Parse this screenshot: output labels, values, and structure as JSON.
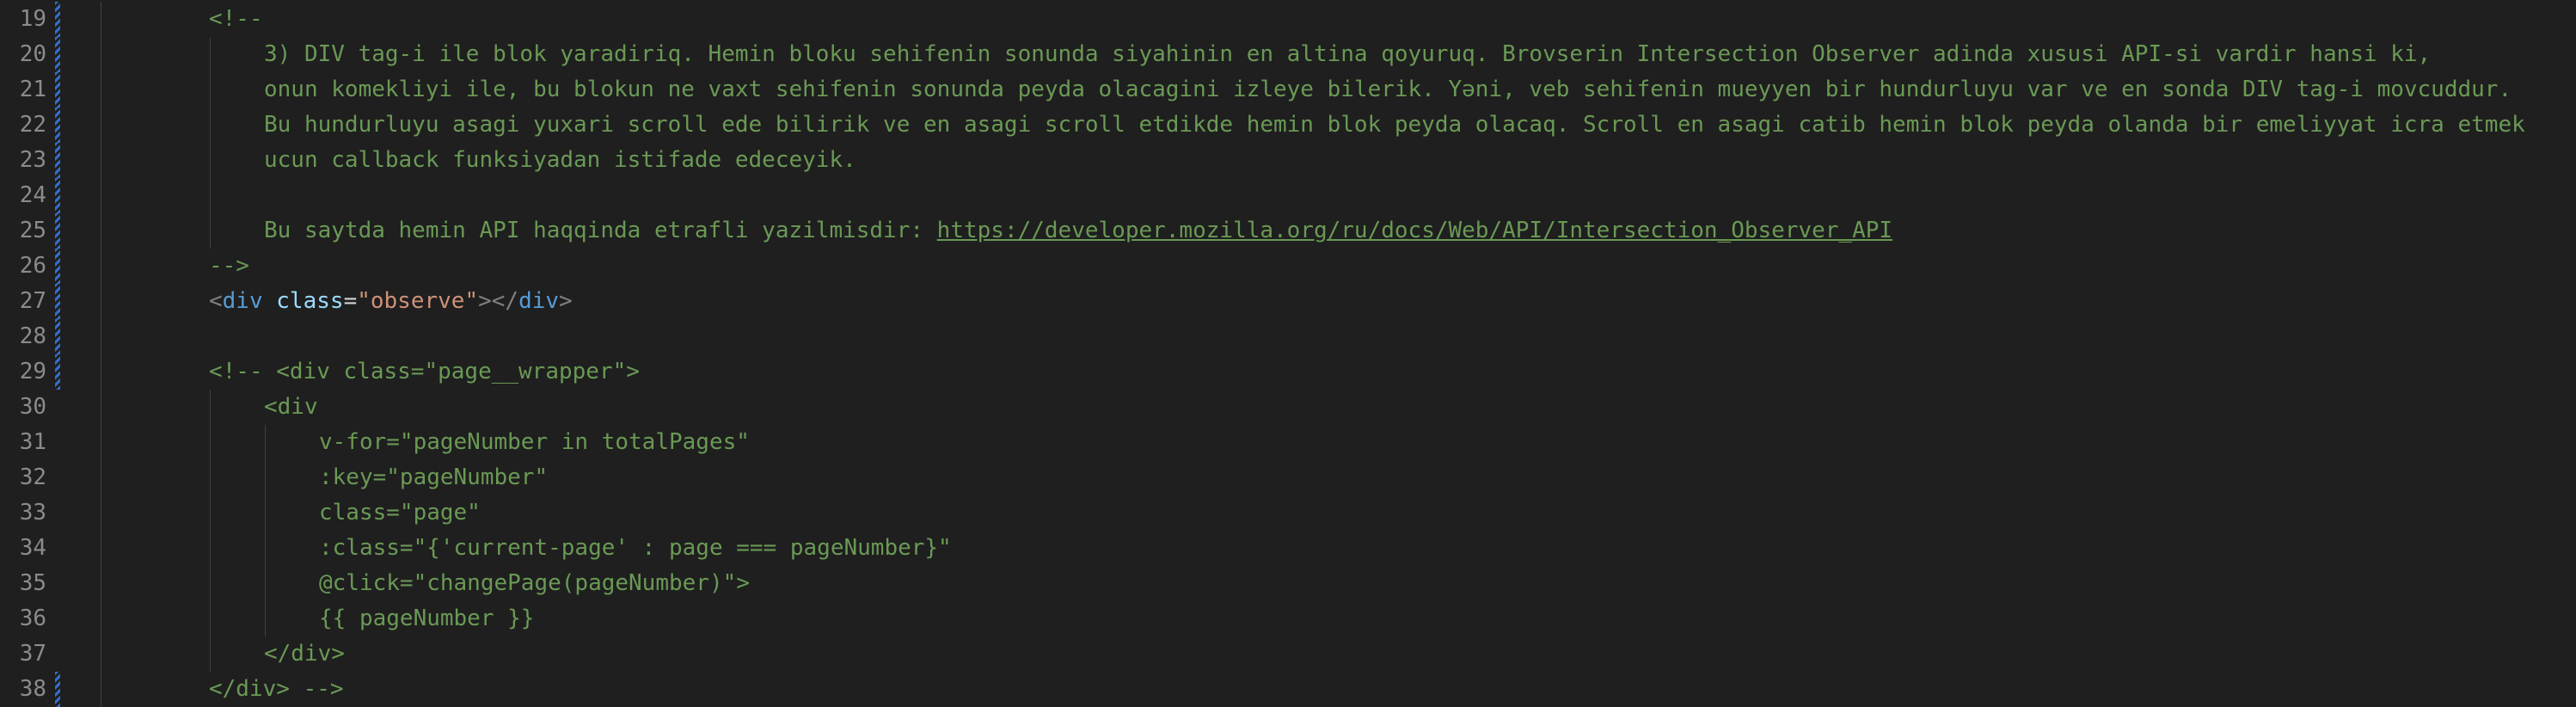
{
  "editor": {
    "lines": [
      {
        "num": "19",
        "indent": 1,
        "guides": [
          1
        ],
        "git": true,
        "segments": [
          {
            "t": "<!--",
            "c": "cm"
          }
        ]
      },
      {
        "num": "20",
        "indent": 2,
        "guides": [
          1,
          2
        ],
        "git": true,
        "segments": [
          {
            "t": "3) DIV tag-i ile blok yaradiriq. Hemin bloku sehifenin sonunda siyahinin en altina qoyuruq. Brovserin Intersection Observer adinda xususi API-si vardir hansi ki,",
            "c": "cm"
          }
        ]
      },
      {
        "num": "21",
        "indent": 2,
        "guides": [
          1,
          2
        ],
        "git": true,
        "segments": [
          {
            "t": "onun komekliyi ile, bu blokun ne vaxt sehifenin sonunda peyda olacagini izleye bilerik. Yəni, veb sehifenin mueyyen bir hundurluyu var ve en sonda DIV tag-i movcuddur.",
            "c": "cm"
          }
        ]
      },
      {
        "num": "22",
        "indent": 2,
        "guides": [
          1,
          2
        ],
        "git": true,
        "segments": [
          {
            "t": "Bu hundurluyu asagi yuxari scroll ede bilirik ve en asagi scroll etdikde hemin blok peyda olacaq. Scroll en asagi catib hemin blok peyda olanda bir emeliyyat icra etmek",
            "c": "cm"
          }
        ]
      },
      {
        "num": "23",
        "indent": 2,
        "guides": [
          1,
          2
        ],
        "git": true,
        "segments": [
          {
            "t": "ucun callback funksiyadan istifade edeceyik.",
            "c": "cm"
          }
        ]
      },
      {
        "num": "24",
        "indent": 2,
        "guides": [
          1,
          2
        ],
        "git": true,
        "segments": []
      },
      {
        "num": "25",
        "indent": 2,
        "guides": [
          1,
          2
        ],
        "git": true,
        "segments": [
          {
            "t": "Bu saytda hemin API haqqinda etrafli yazilmisdir: ",
            "c": "cm"
          },
          {
            "t": "https://developer.mozilla.org/ru/docs/Web/API/Intersection_Observer_API",
            "c": "link"
          }
        ]
      },
      {
        "num": "26",
        "indent": 1,
        "guides": [
          1
        ],
        "git": true,
        "segments": [
          {
            "t": "-->",
            "c": "cm"
          }
        ]
      },
      {
        "num": "27",
        "indent": 1,
        "guides": [
          1
        ],
        "git": true,
        "segments": [
          {
            "t": "<",
            "c": "punc"
          },
          {
            "t": "div",
            "c": "tag"
          },
          {
            "t": " ",
            "c": "plain"
          },
          {
            "t": "class",
            "c": "attr"
          },
          {
            "t": "=",
            "c": "plain"
          },
          {
            "t": "\"observe\"",
            "c": "str"
          },
          {
            "t": "></",
            "c": "punc"
          },
          {
            "t": "div",
            "c": "tag"
          },
          {
            "t": ">",
            "c": "punc"
          }
        ]
      },
      {
        "num": "28",
        "indent": 1,
        "guides": [
          1
        ],
        "git": true,
        "segments": []
      },
      {
        "num": "29",
        "indent": 1,
        "guides": [
          1
        ],
        "git": true,
        "segments": [
          {
            "t": "<!-- <div class=\"page__wrapper\">",
            "c": "cm"
          }
        ]
      },
      {
        "num": "30",
        "indent": 2,
        "guides": [
          1,
          2
        ],
        "git": false,
        "segments": [
          {
            "t": "<div",
            "c": "cm"
          }
        ]
      },
      {
        "num": "31",
        "indent": 3,
        "guides": [
          1,
          2,
          3
        ],
        "git": false,
        "segments": [
          {
            "t": "v-for=\"pageNumber in totalPages\"",
            "c": "cm"
          }
        ]
      },
      {
        "num": "32",
        "indent": 3,
        "guides": [
          1,
          2,
          3
        ],
        "git": false,
        "segments": [
          {
            "t": ":key=\"pageNumber\"",
            "c": "cm"
          }
        ]
      },
      {
        "num": "33",
        "indent": 3,
        "guides": [
          1,
          2,
          3
        ],
        "git": false,
        "segments": [
          {
            "t": "class=\"page\"",
            "c": "cm"
          }
        ]
      },
      {
        "num": "34",
        "indent": 3,
        "guides": [
          1,
          2,
          3
        ],
        "git": false,
        "segments": [
          {
            "t": ":class=\"{'current-page' : page === pageNumber}\"",
            "c": "cm"
          }
        ]
      },
      {
        "num": "35",
        "indent": 3,
        "guides": [
          1,
          2,
          3
        ],
        "git": false,
        "segments": [
          {
            "t": "@click=\"changePage(pageNumber)\">",
            "c": "cm"
          }
        ]
      },
      {
        "num": "36",
        "indent": 3,
        "guides": [
          1,
          2,
          3
        ],
        "git": false,
        "segments": [
          {
            "t": "{{ pageNumber }}",
            "c": "cm"
          }
        ]
      },
      {
        "num": "37",
        "indent": 2,
        "guides": [
          1,
          2
        ],
        "git": false,
        "segments": [
          {
            "t": "</div>",
            "c": "cm"
          }
        ]
      },
      {
        "num": "38",
        "indent": 1,
        "guides": [
          1
        ],
        "git": true,
        "segments": [
          {
            "t": "</div> -->",
            "c": "cm"
          }
        ]
      }
    ]
  }
}
